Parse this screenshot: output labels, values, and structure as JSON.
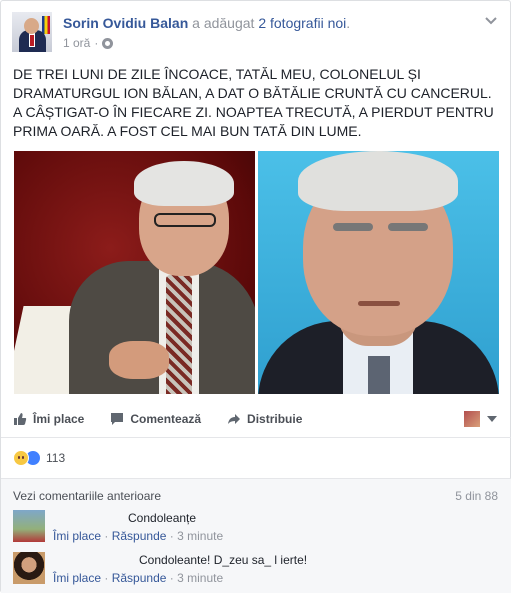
{
  "post": {
    "author": "Sorin Ovidiu Balan",
    "action_prefix": "a adăugat",
    "action_link": "2 fotografii noi",
    "action_suffix": ".",
    "time": "1 oră",
    "meta_separator": "·",
    "text": "DE TREI LUNI DE ZILE ÎNCOACE, TATĂL MEU, COLONELUL ȘI DRAMATURGUL ION BĂLAN, A DAT O BĂTĂLIE CRUNTĂ CU CANCERUL. A CÂȘTIGAT-O ÎN FIECARE ZI. NOAPTEA TRECUTĂ, A PIERDUT PENTRU PRIMA OARĂ. A FOST CEL MAI BUN TATĂ DIN LUME."
  },
  "actions": {
    "like_label": "Îmi place",
    "comment_label": "Comentează",
    "share_label": "Distribuie"
  },
  "reactions": {
    "count": "113",
    "types": [
      "sad-icon",
      "like-icon"
    ]
  },
  "comments": {
    "previous_label": "Vezi comentariile anterioare",
    "count_label": "5 din 88",
    "items": [
      {
        "text": "Condoleanțe",
        "like_label": "Îmi place",
        "reply_label": "Răspunde",
        "separator": "·",
        "time": "3 minute"
      },
      {
        "text": "Condoleante! D_zeu sa_ l ierte!",
        "like_label": "Îmi place",
        "reply_label": "Răspunde",
        "separator": "·",
        "time": "3 minute"
      }
    ]
  },
  "colors": {
    "link": "#365899",
    "muted": "#90949c",
    "text": "#1d2129",
    "like_blue": "#4080ff",
    "comment_bg": "#f6f7f9"
  }
}
